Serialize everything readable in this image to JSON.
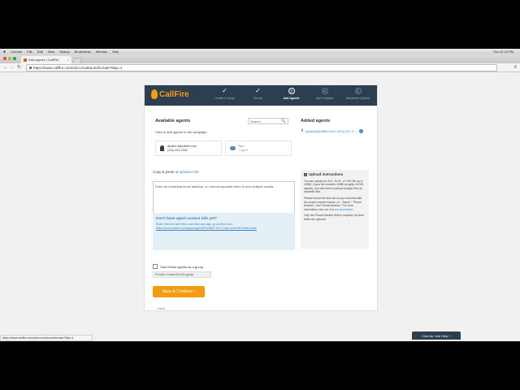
{
  "menubar": {
    "apple": "",
    "items": [
      "Chrome",
      "File",
      "Edit",
      "View",
      "History",
      "Bookmarks",
      "Window",
      "Help"
    ],
    "clock": "Thu 12:13 PM"
  },
  "tab": {
    "title": "Add Agents | CallFire",
    "close": "×"
  },
  "address": {
    "url": "https://www.callfire.com/ui/ccc/outbound/create?5&p=4",
    "back": "←",
    "forward": "→",
    "reload": "↻",
    "menu": "≡"
  },
  "brand": {
    "name": "CallFire",
    "color": "#f39c12"
  },
  "steps": [
    {
      "label": "Create & Script",
      "mark": "✓"
    },
    {
      "label": "Survey",
      "mark": "✓"
    },
    {
      "label": "Add Agents",
      "mark": "3"
    },
    {
      "label": "Add Contacts",
      "mark": "4"
    },
    {
      "label": "Advanced Options",
      "mark": "5"
    }
  ],
  "available": {
    "title": "Available agents",
    "subtitle": "Click to add agents to the campaign",
    "search_placeholder": "Search",
    "search_icon": "🔍",
    "agent": {
      "email": "dpatlu+4@callfire.com",
      "phone": "(310) 401-2262"
    },
    "group": {
      "name": "Test",
      "count": "1 agent"
    }
  },
  "added": {
    "title": "Added agents",
    "item": "dpatlu4@callfire.com (310) 317-9...",
    "plus": "+"
  },
  "copy": {
    "label": "Copy & paste or",
    "upload_link": "upload a list",
    "placeholder": "Enter an individual email address, or comma separate them to add multiple emails"
  },
  "upload": {
    "title": "Upload instructions",
    "p1": "You can upload an XLS, XLSX, or CSV file up to 10MB. If your file exceeds 10MB (roughly 40,000 agents), you will need to upload multiple files as separate lists.",
    "p2": "Please format the first row of your columns with the proper column names, i.e.: \"Name,\" \"Phone Number,\" and \"Email Address.\" For more information, see our",
    "p2_link": "help documentation.",
    "p3": "Only the Phone Number field is required; all other fields are optional."
  },
  "contact": {
    "title": "Don't have agent contact info yet?",
    "desc": "Share this link with them and they can sign up on their own:",
    "url": "https://www.callfire.com/agentagent/5Fa4B0F-9ef7-14be-4eb0-967b9e81c5de"
  },
  "save_group": {
    "label": "Save these agents as a group",
    "name_placeholder": "Provide a name for this group"
  },
  "save_button": "Save & Continue ›",
  "back_link": "‹ back",
  "status_bar": "https://www.callfire.com/ui/ccc/outbound/create?5&p=4",
  "live_help": "Click for Live Help  +"
}
